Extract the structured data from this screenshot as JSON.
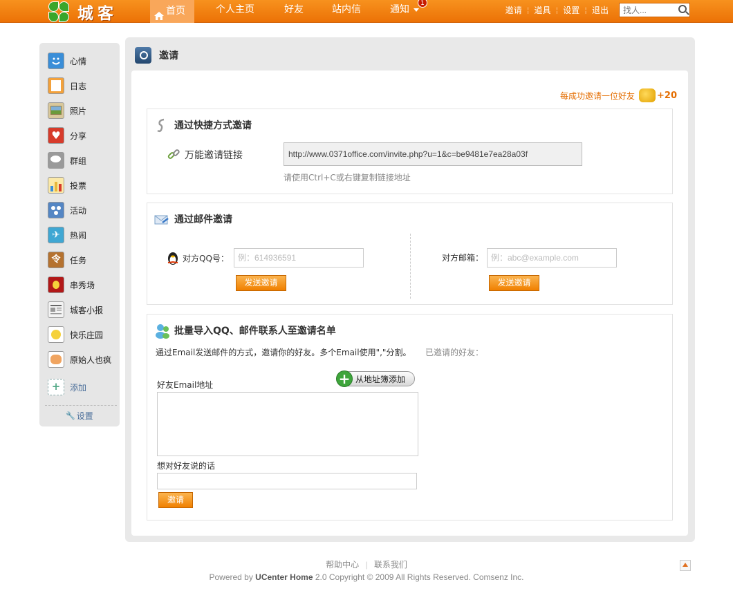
{
  "header": {
    "logo_text": "城客",
    "nav": [
      {
        "label": "首页",
        "active": true
      },
      {
        "label": "个人主页"
      },
      {
        "label": "好友"
      },
      {
        "label": "站内信"
      },
      {
        "label": "通知",
        "badge": "1"
      }
    ],
    "right_links": [
      "邀请",
      "道具",
      "设置",
      "退出"
    ],
    "search_placeholder": "找人..."
  },
  "sidebar": {
    "items": [
      {
        "label": "心情",
        "icon": "smiley-icon",
        "color": "#3a8ed8"
      },
      {
        "label": "日志",
        "icon": "notebook-icon",
        "color": "#f3a13b"
      },
      {
        "label": "照片",
        "icon": "photo-icon",
        "color": "#8b7b4a"
      },
      {
        "label": "分享",
        "icon": "heart-icon",
        "color": "#d73b2b"
      },
      {
        "label": "群组",
        "icon": "chat-bubbles-icon",
        "color": "#9a9a9a"
      },
      {
        "label": "投票",
        "icon": "bar-chart-icon",
        "color": "#e7b73a"
      },
      {
        "label": "活动",
        "icon": "people-icon",
        "color": "#5486c4"
      },
      {
        "label": "热闹",
        "icon": "running-man-icon",
        "color": "#3fa7d3"
      },
      {
        "label": "任务",
        "icon": "task-icon",
        "color": "#b5722f"
      },
      {
        "label": "串秀场",
        "icon": "stage-icon",
        "color": "#b21818"
      },
      {
        "label": "城客小报",
        "icon": "newspaper-icon",
        "color": "#cfcfcf"
      },
      {
        "label": "快乐庄园",
        "icon": "chick-icon",
        "color": "#f5d13b"
      },
      {
        "label": "原始人也疯",
        "icon": "caveman-icon",
        "color": "#f0a460"
      }
    ],
    "add_label": "添加",
    "settings_label": "设置"
  },
  "main": {
    "title": "邀请",
    "reward_text": "每成功邀请一位好友",
    "reward_points": "+20",
    "quick": {
      "title": "通过快捷方式邀请",
      "link_label": "万能邀请链接",
      "url": "http://www.0371office.com/invite.php?u=1&c=be9481e7ea28a03f",
      "hint": "请使用Ctrl+C或右键复制链接地址"
    },
    "mail": {
      "title": "通过邮件邀请",
      "qq_label": "对方QQ号：",
      "qq_placeholder": "例：614936591",
      "email_label": "对方邮箱：",
      "email_placeholder": "例：abc@example.com",
      "send_label": "发送邀请"
    },
    "batch": {
      "title": "批量导入QQ、邮件联系人至邀请名单",
      "desc": "通过Email发送邮件的方式，邀请你的好友。多个Email使用\",\"分割。",
      "invited_label": "已邀请的好友：",
      "addbook_label": "从地址簿添加",
      "emails_label": "好友Email地址",
      "message_label": "想对好友说的话",
      "invite_label": "邀请"
    }
  },
  "footer": {
    "links": [
      "帮助中心",
      "联系我们"
    ],
    "copyright_prefix": "Powered by ",
    "brand": "UCenter Home",
    "copyright_suffix": " 2.0 Copyright © 2009 All Rights Reserved. Comsenz Inc."
  }
}
